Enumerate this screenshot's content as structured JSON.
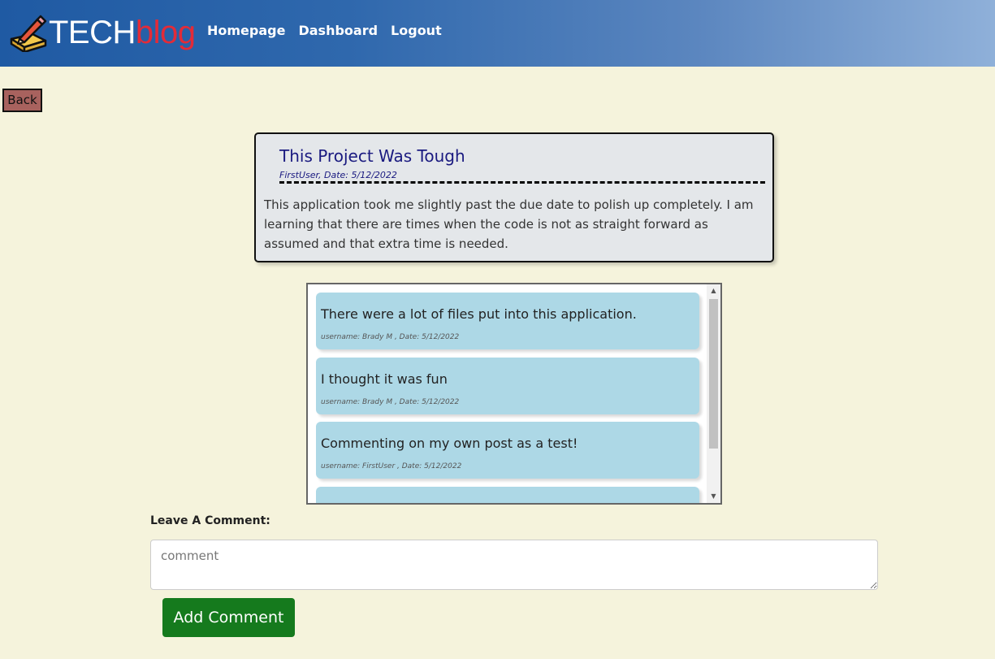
{
  "header": {
    "logo_part1": "TECH",
    "logo_part2": "blog",
    "logo_icon": "pencil-paper-icon",
    "nav": [
      "Homepage",
      "Dashboard",
      "Logout"
    ]
  },
  "back_label": "Back",
  "post": {
    "title": "This Project Was Tough",
    "meta": "FirstUser, Date: 5/12/2022",
    "body": "This application took me slightly past the due date to polish up completely. I am learning that there are times when the code is not as straight forward as assumed and that extra time is needed."
  },
  "comments": [
    {
      "text": "There were a lot of files put into this application.",
      "meta": "username: Brady M , Date: 5/12/2022"
    },
    {
      "text": "I thought it was fun",
      "meta": "username: Brady M , Date: 5/12/2022"
    },
    {
      "text": "Commenting on my own post as a test!",
      "meta": "username: FirstUser , Date: 5/12/2022"
    },
    {
      "text": "",
      "meta": ""
    }
  ],
  "comment_form": {
    "label": "Leave A Comment:",
    "placeholder": "comment",
    "value": "",
    "submit_label": "Add Comment"
  },
  "colors": {
    "page_bg": "#f5f3dc",
    "header_start": "#1f5aa3",
    "header_end": "#8fb0d9",
    "logo_accent": "#e32b38",
    "back_button": "#a8625e",
    "comment_card": "#add8e6",
    "submit_button": "#157a1d",
    "post_title": "#1a1a80"
  }
}
